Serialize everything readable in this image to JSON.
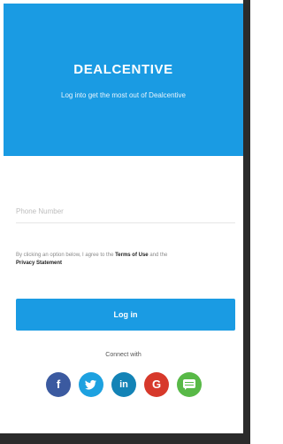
{
  "header": {
    "brand": "DEALCENTIVE",
    "tagline": "Log into get the most out of Dealcentive"
  },
  "form": {
    "phone_placeholder": "Phone Number",
    "phone_value": "",
    "terms_prefix": "By clicking an option below, I agree to the ",
    "terms_link": "Terms of Use",
    "terms_middle": " and the ",
    "privacy_link": "Privacy Statement",
    "login_label": "Log in"
  },
  "social": {
    "heading": "Connect with",
    "items": [
      {
        "name": "facebook",
        "glyph": "f",
        "color": "#3b5aa0"
      },
      {
        "name": "twitter",
        "glyph": "t",
        "color": "#1da1e0"
      },
      {
        "name": "linkedin",
        "glyph": "in",
        "color": "#1383b6"
      },
      {
        "name": "google",
        "glyph": "G",
        "color": "#d7392b"
      },
      {
        "name": "sms",
        "glyph": "",
        "color": "#58b947"
      }
    ]
  },
  "colors": {
    "primary": "#1a9be3"
  }
}
